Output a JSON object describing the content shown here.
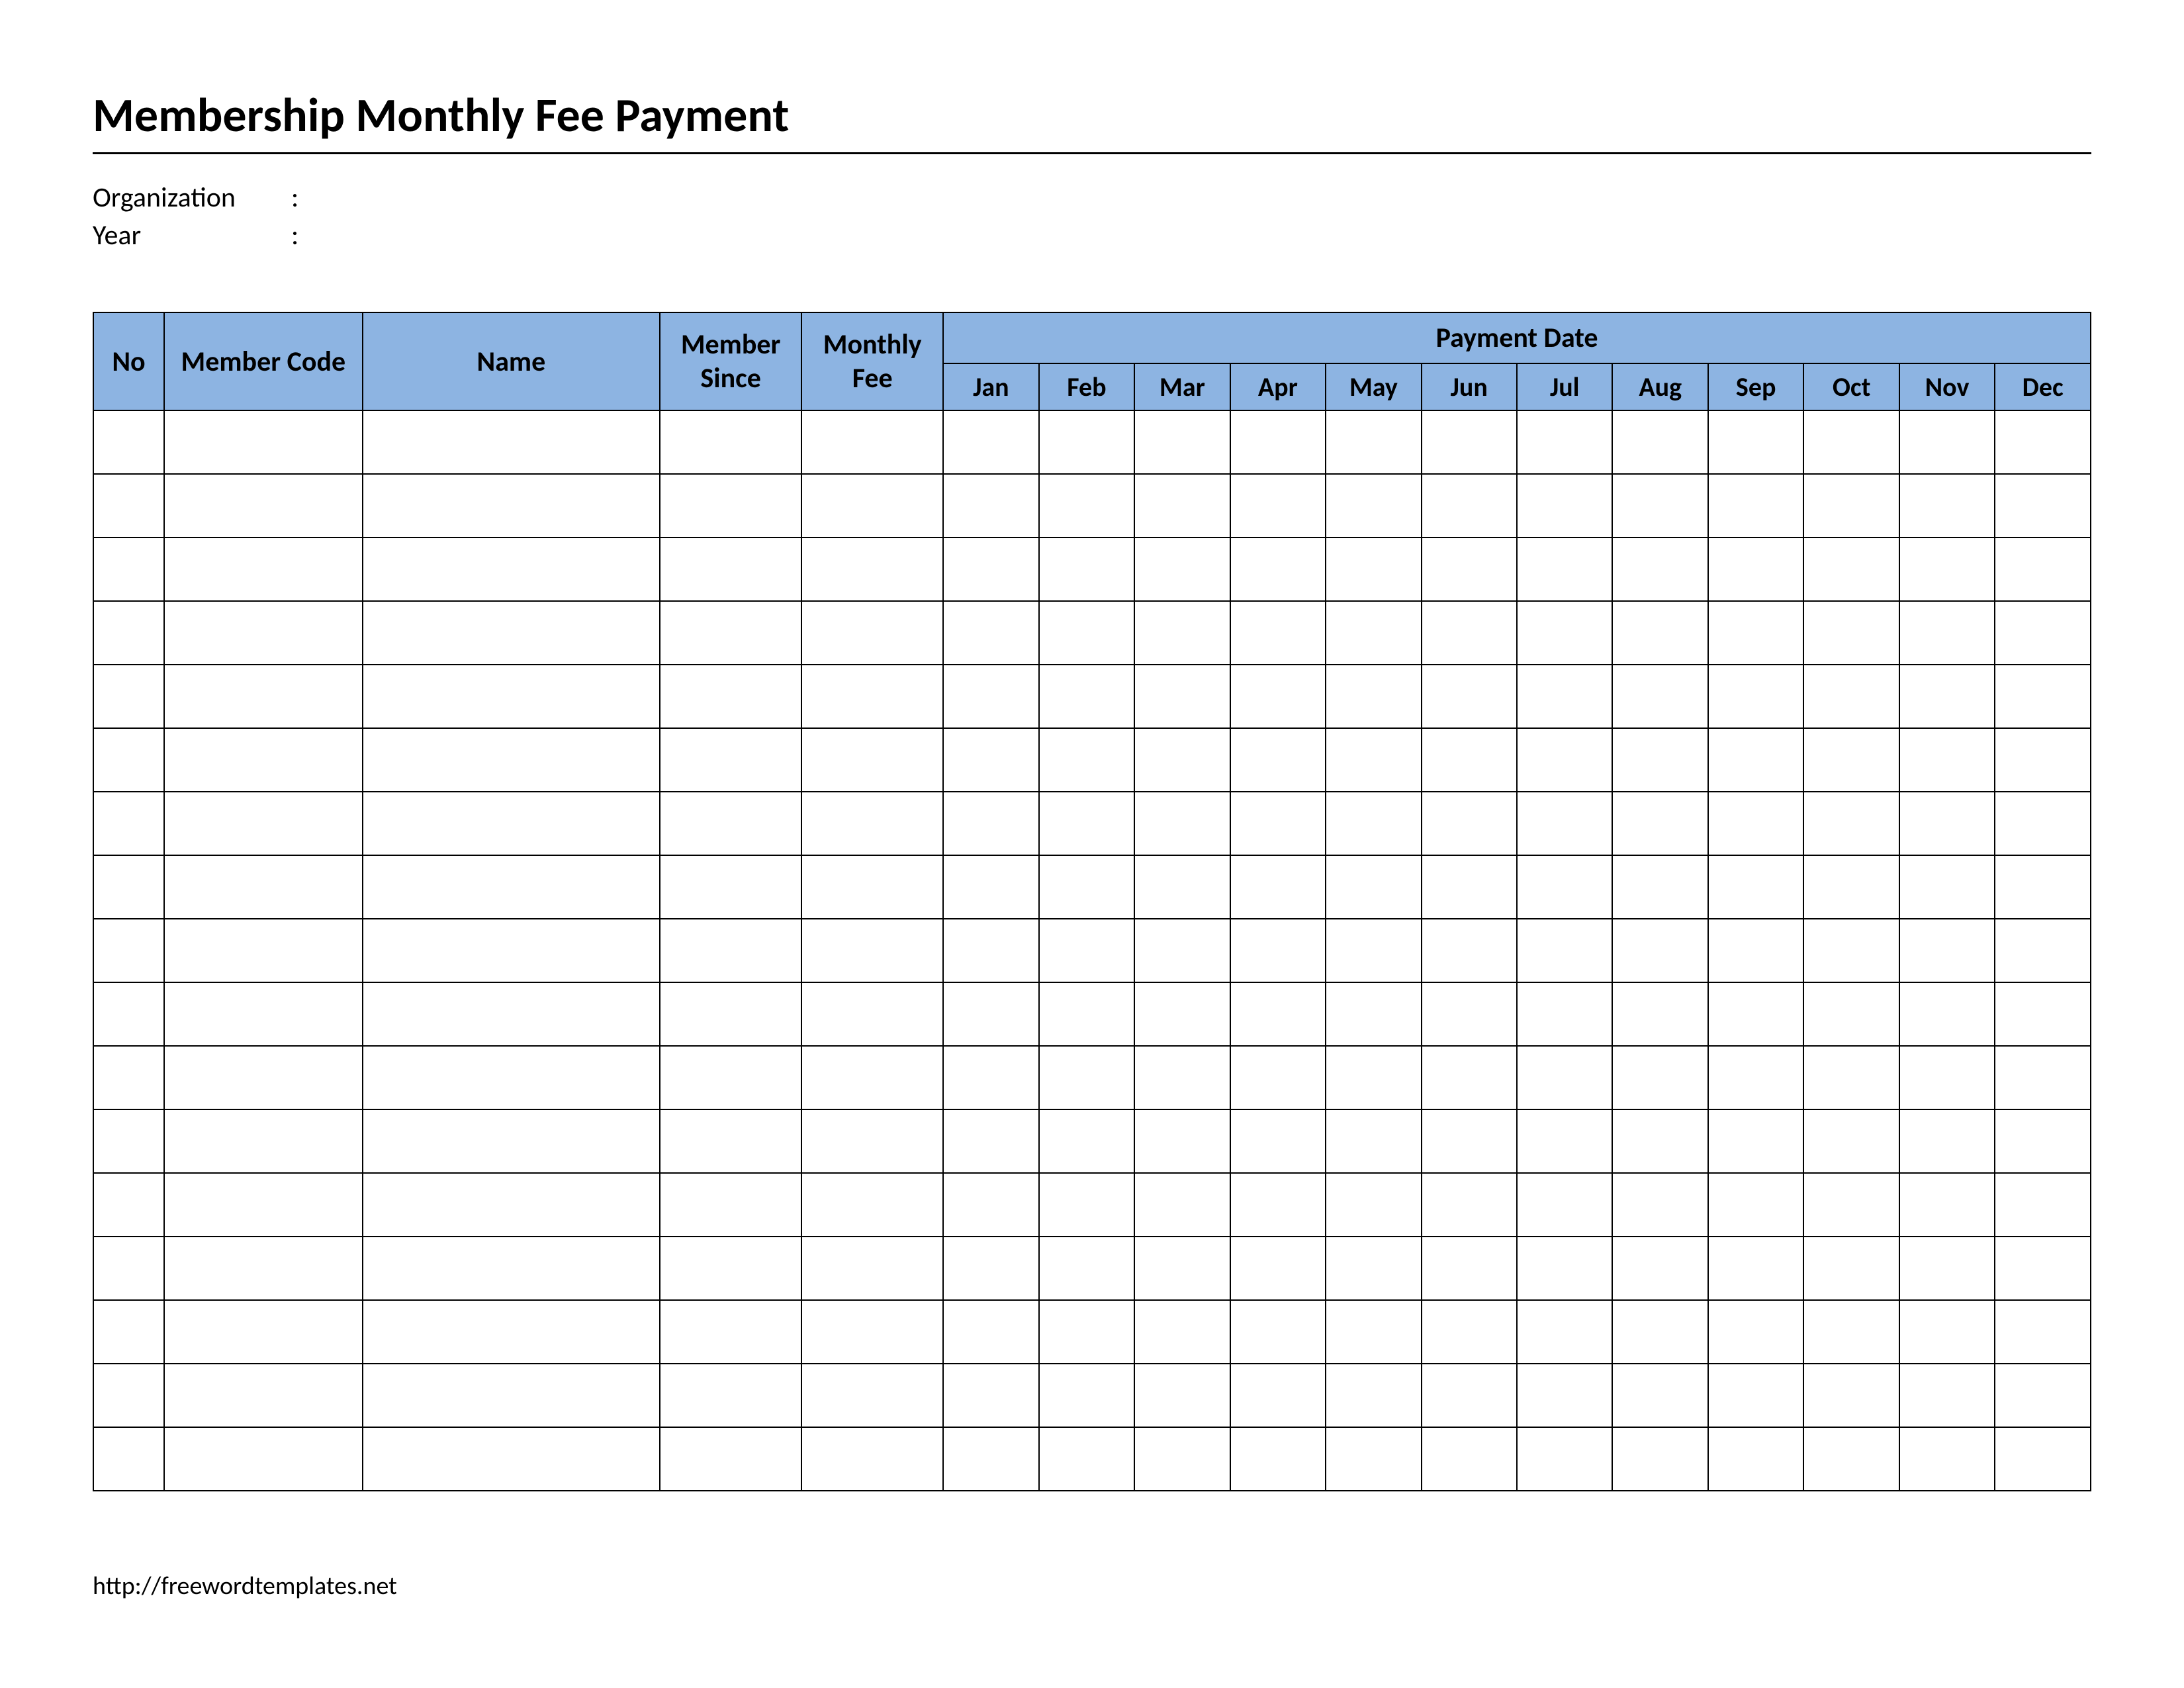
{
  "title": "Membership Monthly Fee Payment",
  "meta": {
    "organization_label": "Organization",
    "year_label": "Year",
    "colon": ":"
  },
  "table": {
    "headers": {
      "no": "No",
      "member_code": "Member Code",
      "name": "Name",
      "member_since": "Member Since",
      "monthly_fee": "Monthly Fee",
      "payment_date": "Payment Date"
    },
    "months": [
      "Jan",
      "Feb",
      "Mar",
      "Apr",
      "May",
      "Jun",
      "Jul",
      "Aug",
      "Sep",
      "Oct",
      "Nov",
      "Dec"
    ],
    "row_count": 17
  },
  "footer": {
    "url": "http://freewordtemplates.net"
  }
}
